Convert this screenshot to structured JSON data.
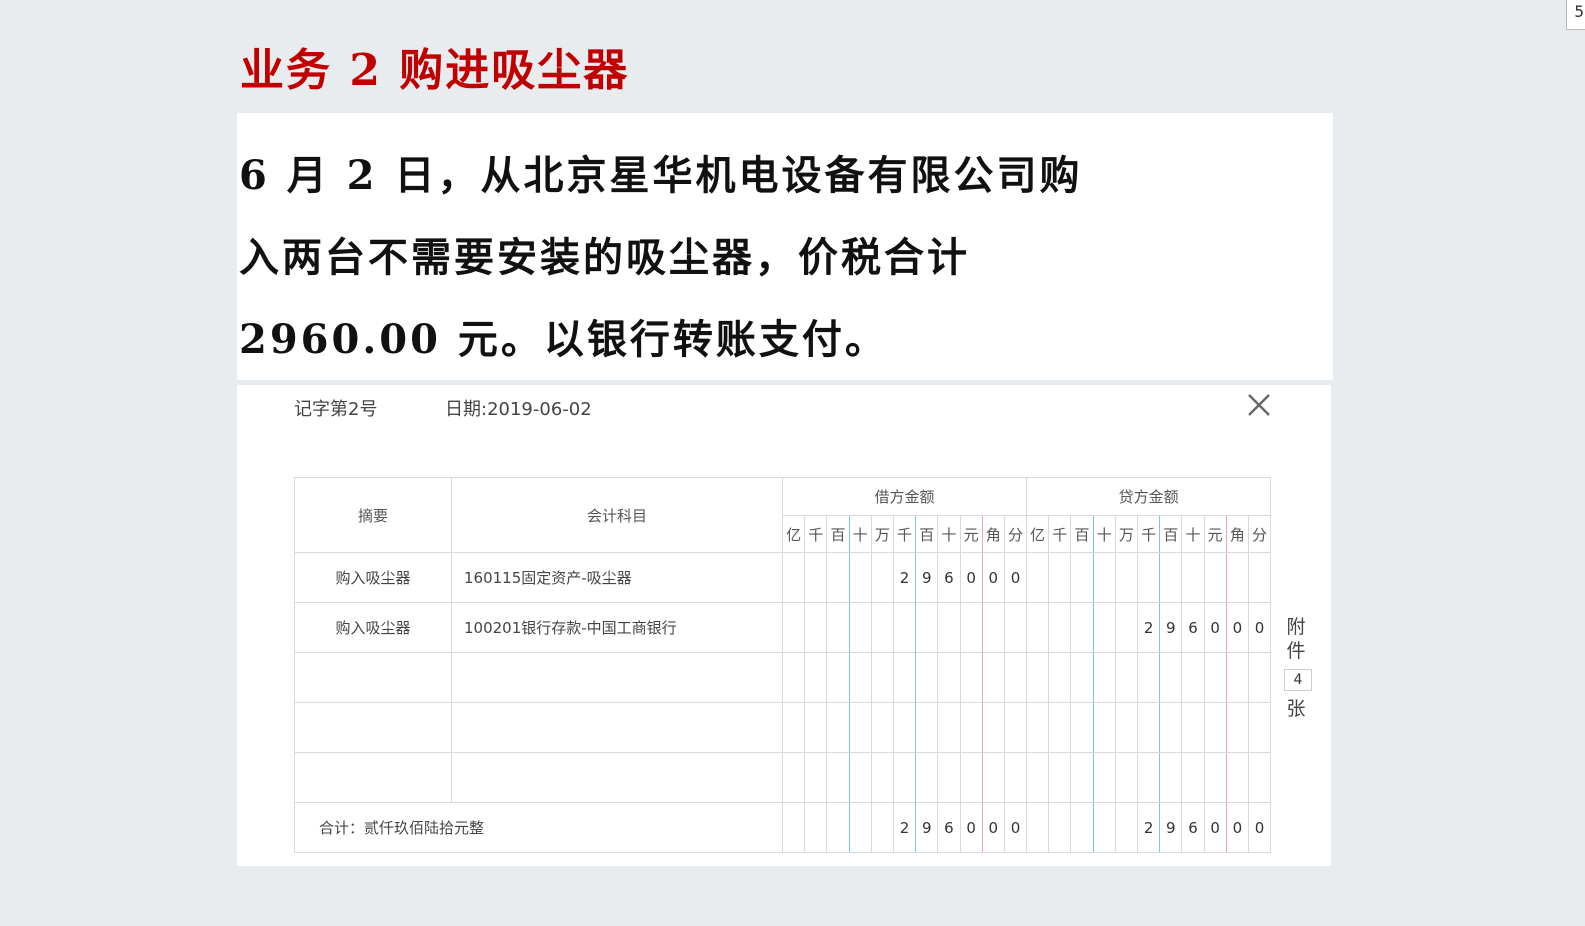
{
  "corner_mark": "5",
  "slide": {
    "title": "业务 2 购进吸尘器",
    "lines": [
      "6 月 2 日，从北京星华机电设备有限公司购",
      "入两台不需要安装的吸尘器，价税合计",
      "2960.00 元。以银行转账支付。"
    ]
  },
  "voucher": {
    "number": "记字第2号",
    "date": "日期:2019-06-02",
    "close_icon": "close-icon",
    "headers": {
      "summary": "摘要",
      "account": "会计科目",
      "debit": "借方金额",
      "credit": "贷方金额",
      "digits": [
        "亿",
        "千",
        "百",
        "十",
        "万",
        "千",
        "百",
        "十",
        "元",
        "角",
        "分"
      ]
    },
    "rows": [
      {
        "summary": "购入吸尘器",
        "account": "160115固定资产-吸尘器",
        "debit": [
          "",
          "",
          "",
          "",
          "",
          "2",
          "9",
          "6",
          "0",
          "0",
          "0"
        ],
        "credit": [
          "",
          "",
          "",
          "",
          "",
          "",
          "",
          "",
          "",
          "",
          ""
        ]
      },
      {
        "summary": "购入吸尘器",
        "account": "100201银行存款-中国工商银行",
        "debit": [
          "",
          "",
          "",
          "",
          "",
          "",
          "",
          "",
          "",
          "",
          ""
        ],
        "credit": [
          "",
          "",
          "",
          "",
          "",
          "2",
          "9",
          "6",
          "0",
          "0",
          "0"
        ]
      },
      {
        "summary": "",
        "account": "",
        "debit": [
          "",
          "",
          "",
          "",
          "",
          "",
          "",
          "",
          "",
          "",
          ""
        ],
        "credit": [
          "",
          "",
          "",
          "",
          "",
          "",
          "",
          "",
          "",
          "",
          ""
        ]
      },
      {
        "summary": "",
        "account": "",
        "debit": [
          "",
          "",
          "",
          "",
          "",
          "",
          "",
          "",
          "",
          "",
          ""
        ],
        "credit": [
          "",
          "",
          "",
          "",
          "",
          "",
          "",
          "",
          "",
          "",
          ""
        ]
      },
      {
        "summary": "",
        "account": "",
        "debit": [
          "",
          "",
          "",
          "",
          "",
          "",
          "",
          "",
          "",
          "",
          ""
        ],
        "credit": [
          "",
          "",
          "",
          "",
          "",
          "",
          "",
          "",
          "",
          "",
          ""
        ]
      }
    ],
    "total": {
      "label": "合计：贰仟玖佰陆拾元整",
      "debit": [
        "",
        "",
        "",
        "",
        "",
        "2",
        "9",
        "6",
        "0",
        "0",
        "0"
      ],
      "credit": [
        "",
        "",
        "",
        "",
        "",
        "2",
        "9",
        "6",
        "0",
        "0",
        "0"
      ]
    },
    "attachment": {
      "label_top": "附件",
      "count": "4",
      "label_bottom": "张"
    }
  }
}
